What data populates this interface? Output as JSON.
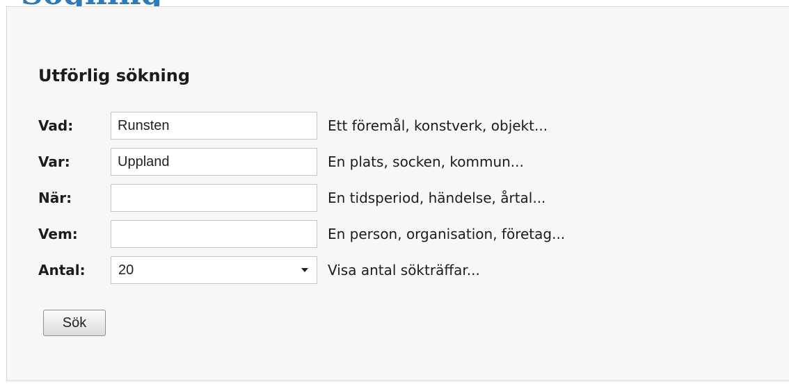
{
  "page": {
    "heading_partial": "Sögning"
  },
  "search_form": {
    "title": "Utförlig sökning",
    "rows": [
      {
        "label": "Vad:",
        "value": "Runsten",
        "hint": "Ett föremål, konstverk, objekt..."
      },
      {
        "label": "Var:",
        "value": "Uppland",
        "hint": "En plats, socken, kommun..."
      },
      {
        "label": "När:",
        "value": "",
        "hint": "En tidsperiod, händelse, årtal..."
      },
      {
        "label": "Vem:",
        "value": "",
        "hint": "En person, organisation, företag..."
      }
    ],
    "count": {
      "label": "Antal:",
      "selected": "20",
      "hint": "Visa antal sökträffar..."
    },
    "submit_label": "Sök"
  },
  "colors": {
    "heading": "#2e79b9",
    "panel_bg": "#f7f7f7"
  }
}
